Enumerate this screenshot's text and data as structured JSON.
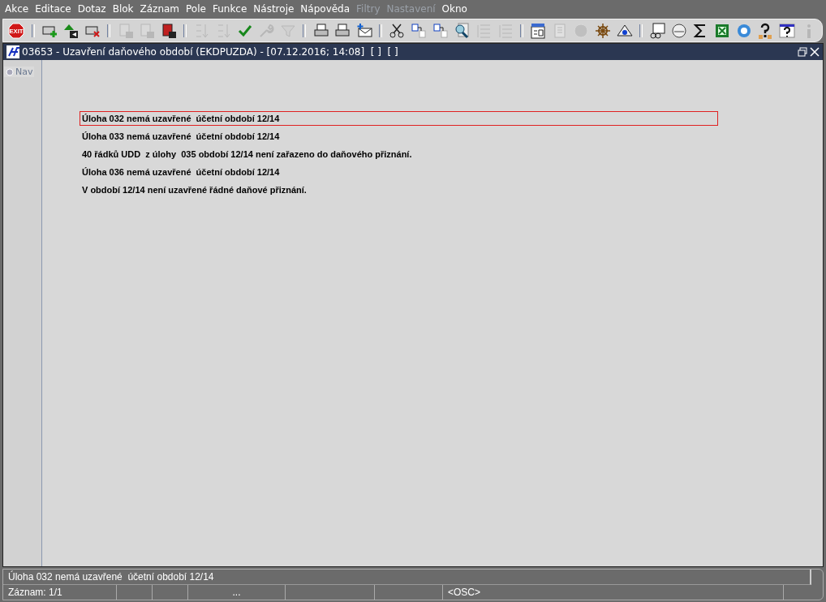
{
  "menu": [
    {
      "label": "Akce",
      "disabled": false
    },
    {
      "label": "Editace",
      "disabled": false
    },
    {
      "label": "Dotaz",
      "disabled": false
    },
    {
      "label": "Blok",
      "disabled": false
    },
    {
      "label": "Záznam",
      "disabled": false
    },
    {
      "label": "Pole",
      "disabled": false
    },
    {
      "label": "Funkce",
      "disabled": false
    },
    {
      "label": "Nástroje",
      "disabled": false
    },
    {
      "label": "Nápověda",
      "disabled": false
    },
    {
      "label": "Filtry",
      "disabled": true
    },
    {
      "label": "Nastavení",
      "disabled": true
    },
    {
      "label": "Okno",
      "disabled": false
    }
  ],
  "toolbar": [
    [
      {
        "kind": "exit",
        "label": "EXIT",
        "disabled": false
      }
    ],
    [
      {
        "kind": "add",
        "disabled": false
      },
      {
        "kind": "tree",
        "disabled": false
      },
      {
        "kind": "remove",
        "disabled": false
      }
    ],
    [
      {
        "kind": "query",
        "disabled": true
      },
      {
        "kind": "run",
        "disabled": true
      },
      {
        "kind": "cancel",
        "disabled": false
      }
    ],
    [
      {
        "kind": "sortup",
        "disabled": true
      },
      {
        "kind": "sortdown",
        "disabled": true
      },
      {
        "kind": "check",
        "disabled": false
      },
      {
        "kind": "wrench",
        "disabled": true
      },
      {
        "kind": "filter",
        "disabled": true
      }
    ],
    [
      {
        "kind": "print",
        "disabled": false
      },
      {
        "kind": "stack",
        "disabled": false
      },
      {
        "kind": "mail",
        "disabled": false
      }
    ],
    [
      {
        "kind": "scissors",
        "disabled": false
      },
      {
        "kind": "swap",
        "disabled": false
      },
      {
        "kind": "swap",
        "disabled": false
      },
      {
        "kind": "search",
        "disabled": false
      },
      {
        "kind": "list",
        "disabled": true
      },
      {
        "kind": "columns",
        "disabled": true
      }
    ],
    [
      {
        "kind": "form",
        "disabled": false
      },
      {
        "kind": "page",
        "disabled": true
      },
      {
        "kind": "globe",
        "disabled": true
      },
      {
        "kind": "wheel",
        "disabled": false
      },
      {
        "kind": "eye",
        "disabled": false
      }
    ],
    [
      {
        "kind": "glasses",
        "disabled": false
      },
      {
        "kind": "clock",
        "disabled": false
      },
      {
        "kind": "sigma",
        "disabled": false
      },
      {
        "kind": "sheet",
        "disabled": false
      },
      {
        "kind": "browser",
        "disabled": false
      },
      {
        "kind": "helpers",
        "disabled": false
      },
      {
        "kind": "help",
        "disabled": false
      },
      {
        "kind": "info",
        "disabled": true
      }
    ]
  ],
  "window": {
    "title": "03653 - Uzavření daňového období (EKDPUZDA) - [07.12.2016; 14:08]  [ ]  [ ]"
  },
  "nav": {
    "label": "Nav",
    "checked": false
  },
  "messages": [
    {
      "text": "Úloha 032 nemá uzavřené  účetní období 12/14",
      "selected": true
    },
    {
      "text": "Úloha 033 nemá uzavřené  účetní období 12/14",
      "selected": false
    },
    {
      "text": "40 řádků UDD  z úlohy  035 období 12/14 není zařazeno do daňového přiznání.",
      "selected": false
    },
    {
      "text": "Úloha 036 nemá uzavřené  účetní období 12/14",
      "selected": false
    },
    {
      "text": "V období 12/14 není uzavřené řádné daňové přiznání.",
      "selected": false
    }
  ],
  "status": {
    "message": "Úloha 032 nemá uzavřené  účetní období 12/14",
    "cells": [
      "Záznam: 1/1",
      "",
      "",
      "...",
      "",
      "",
      "<OSC>"
    ]
  }
}
